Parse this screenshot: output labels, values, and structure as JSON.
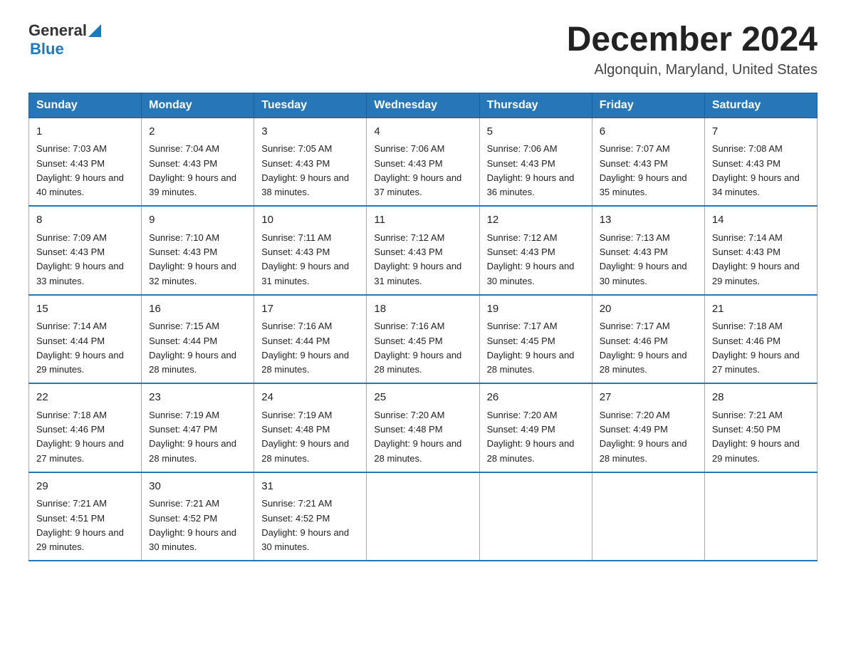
{
  "header": {
    "logo_general": "General",
    "logo_blue": "Blue",
    "month_title": "December 2024",
    "location": "Algonquin, Maryland, United States"
  },
  "days_of_week": [
    "Sunday",
    "Monday",
    "Tuesday",
    "Wednesday",
    "Thursday",
    "Friday",
    "Saturday"
  ],
  "weeks": [
    [
      {
        "day": "1",
        "sunrise": "7:03 AM",
        "sunset": "4:43 PM",
        "daylight": "9 hours and 40 minutes."
      },
      {
        "day": "2",
        "sunrise": "7:04 AM",
        "sunset": "4:43 PM",
        "daylight": "9 hours and 39 minutes."
      },
      {
        "day": "3",
        "sunrise": "7:05 AM",
        "sunset": "4:43 PM",
        "daylight": "9 hours and 38 minutes."
      },
      {
        "day": "4",
        "sunrise": "7:06 AM",
        "sunset": "4:43 PM",
        "daylight": "9 hours and 37 minutes."
      },
      {
        "day": "5",
        "sunrise": "7:06 AM",
        "sunset": "4:43 PM",
        "daylight": "9 hours and 36 minutes."
      },
      {
        "day": "6",
        "sunrise": "7:07 AM",
        "sunset": "4:43 PM",
        "daylight": "9 hours and 35 minutes."
      },
      {
        "day": "7",
        "sunrise": "7:08 AM",
        "sunset": "4:43 PM",
        "daylight": "9 hours and 34 minutes."
      }
    ],
    [
      {
        "day": "8",
        "sunrise": "7:09 AM",
        "sunset": "4:43 PM",
        "daylight": "9 hours and 33 minutes."
      },
      {
        "day": "9",
        "sunrise": "7:10 AM",
        "sunset": "4:43 PM",
        "daylight": "9 hours and 32 minutes."
      },
      {
        "day": "10",
        "sunrise": "7:11 AM",
        "sunset": "4:43 PM",
        "daylight": "9 hours and 31 minutes."
      },
      {
        "day": "11",
        "sunrise": "7:12 AM",
        "sunset": "4:43 PM",
        "daylight": "9 hours and 31 minutes."
      },
      {
        "day": "12",
        "sunrise": "7:12 AM",
        "sunset": "4:43 PM",
        "daylight": "9 hours and 30 minutes."
      },
      {
        "day": "13",
        "sunrise": "7:13 AM",
        "sunset": "4:43 PM",
        "daylight": "9 hours and 30 minutes."
      },
      {
        "day": "14",
        "sunrise": "7:14 AM",
        "sunset": "4:43 PM",
        "daylight": "9 hours and 29 minutes."
      }
    ],
    [
      {
        "day": "15",
        "sunrise": "7:14 AM",
        "sunset": "4:44 PM",
        "daylight": "9 hours and 29 minutes."
      },
      {
        "day": "16",
        "sunrise": "7:15 AM",
        "sunset": "4:44 PM",
        "daylight": "9 hours and 28 minutes."
      },
      {
        "day": "17",
        "sunrise": "7:16 AM",
        "sunset": "4:44 PM",
        "daylight": "9 hours and 28 minutes."
      },
      {
        "day": "18",
        "sunrise": "7:16 AM",
        "sunset": "4:45 PM",
        "daylight": "9 hours and 28 minutes."
      },
      {
        "day": "19",
        "sunrise": "7:17 AM",
        "sunset": "4:45 PM",
        "daylight": "9 hours and 28 minutes."
      },
      {
        "day": "20",
        "sunrise": "7:17 AM",
        "sunset": "4:46 PM",
        "daylight": "9 hours and 28 minutes."
      },
      {
        "day": "21",
        "sunrise": "7:18 AM",
        "sunset": "4:46 PM",
        "daylight": "9 hours and 27 minutes."
      }
    ],
    [
      {
        "day": "22",
        "sunrise": "7:18 AM",
        "sunset": "4:46 PM",
        "daylight": "9 hours and 27 minutes."
      },
      {
        "day": "23",
        "sunrise": "7:19 AM",
        "sunset": "4:47 PM",
        "daylight": "9 hours and 28 minutes."
      },
      {
        "day": "24",
        "sunrise": "7:19 AM",
        "sunset": "4:48 PM",
        "daylight": "9 hours and 28 minutes."
      },
      {
        "day": "25",
        "sunrise": "7:20 AM",
        "sunset": "4:48 PM",
        "daylight": "9 hours and 28 minutes."
      },
      {
        "day": "26",
        "sunrise": "7:20 AM",
        "sunset": "4:49 PM",
        "daylight": "9 hours and 28 minutes."
      },
      {
        "day": "27",
        "sunrise": "7:20 AM",
        "sunset": "4:49 PM",
        "daylight": "9 hours and 28 minutes."
      },
      {
        "day": "28",
        "sunrise": "7:21 AM",
        "sunset": "4:50 PM",
        "daylight": "9 hours and 29 minutes."
      }
    ],
    [
      {
        "day": "29",
        "sunrise": "7:21 AM",
        "sunset": "4:51 PM",
        "daylight": "9 hours and 29 minutes."
      },
      {
        "day": "30",
        "sunrise": "7:21 AM",
        "sunset": "4:52 PM",
        "daylight": "9 hours and 30 minutes."
      },
      {
        "day": "31",
        "sunrise": "7:21 AM",
        "sunset": "4:52 PM",
        "daylight": "9 hours and 30 minutes."
      },
      null,
      null,
      null,
      null
    ]
  ]
}
